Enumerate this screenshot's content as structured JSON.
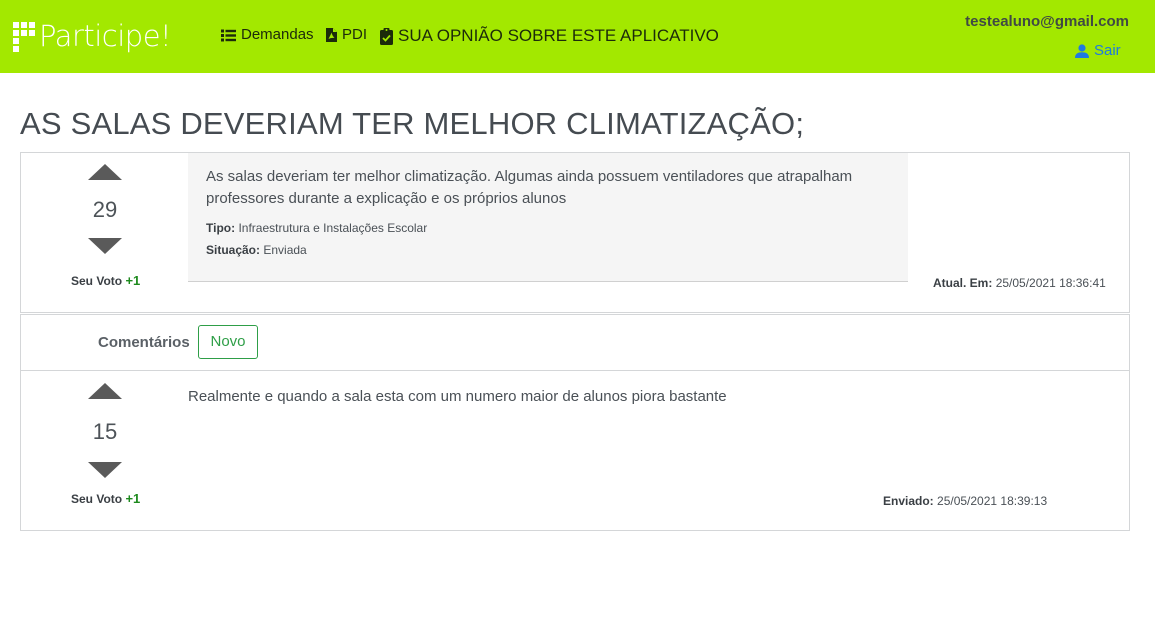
{
  "navbar": {
    "brand": "Participe!",
    "items": [
      {
        "label": "Demandas",
        "icon": "list-icon"
      },
      {
        "label": "PDI",
        "icon": "file-pdf-icon"
      },
      {
        "label": "SUA OPNIÃO SOBRE ESTE APLICATIVO",
        "icon": "clipboard-check-icon"
      }
    ],
    "user_email": "testealuno@gmail.com",
    "logout_label": "Sair",
    "colors": {
      "background": "#a3e800",
      "link": "#1f7ae0"
    }
  },
  "page": {
    "title": "AS SALAS DEVERIAM TER MELHOR CLIMATIZAÇÃO;"
  },
  "demand": {
    "votes": "29",
    "your_vote_label": "Seu Voto",
    "your_vote_value": "+1",
    "description": "As salas deveriam ter melhor climatização. Algumas ainda possuem ventiladores que atrapalham professores durante a explicação e os próprios alunos",
    "type_label": "Tipo:",
    "type_value": "Infraestrutura e Instalações Escolar",
    "status_label": "Situação:",
    "status_value": "Enviada",
    "updated_label": "Atual. Em:",
    "updated_value": "25/05/2021 18:36:41"
  },
  "comments": {
    "label": "Comentários",
    "new_button": "Novo",
    "items": [
      {
        "votes": "15",
        "your_vote_label": "Seu Voto",
        "your_vote_value": "+1",
        "text": "Realmente e quando a sala esta com um numero maior de alunos piora bastante",
        "sent_label": "Enviado:",
        "sent_value": "25/05/2021 18:39:13"
      }
    ]
  }
}
